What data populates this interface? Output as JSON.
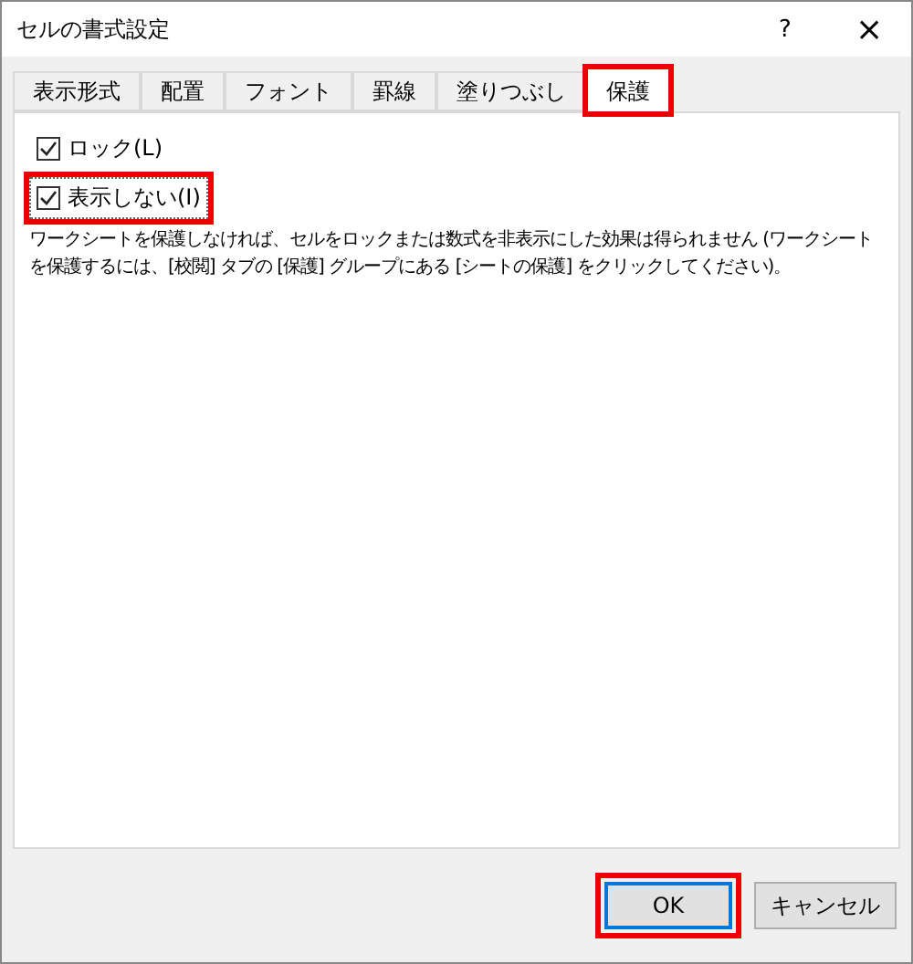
{
  "window": {
    "title": "セルの書式設定",
    "help": "?",
    "close": "×"
  },
  "tabs": [
    {
      "label": "表示形式",
      "selected": false,
      "highlighted": false
    },
    {
      "label": "配置",
      "selected": false,
      "highlighted": false
    },
    {
      "label": "フォント",
      "selected": false,
      "highlighted": false
    },
    {
      "label": "罫線",
      "selected": false,
      "highlighted": false
    },
    {
      "label": "塗りつぶし",
      "selected": false,
      "highlighted": false
    },
    {
      "label": "保護",
      "selected": true,
      "highlighted": true
    }
  ],
  "options": [
    {
      "label": "ロック(L)",
      "checked": true,
      "highlighted": false,
      "focused": false
    },
    {
      "label": "表示しない(I)",
      "checked": true,
      "highlighted": true,
      "focused": true
    }
  ],
  "description": "ワークシートを保護しなければ、セルをロックまたは数式を非表示にした効果は得られません (ワークシートを保護するには、[校閲] タブの [保護] グループにある [シートの保護] をクリックしてください)。",
  "buttons": [
    {
      "label": "OK",
      "default": true,
      "highlighted": true
    },
    {
      "label": "キャンセル",
      "default": false,
      "highlighted": false
    }
  ]
}
